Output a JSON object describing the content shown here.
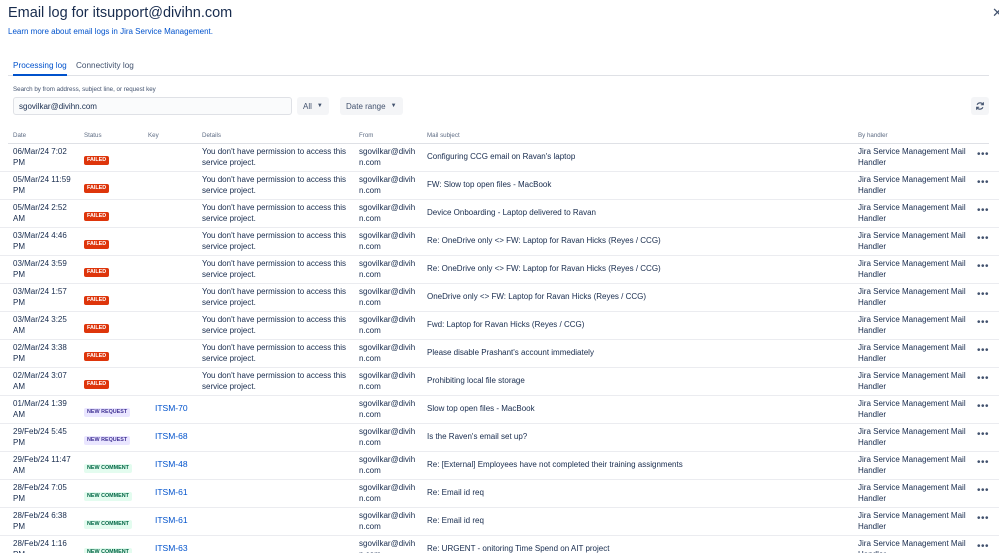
{
  "header": {
    "title": "Email log for itsupport@divihn.com",
    "learn_link": "Learn more about email logs in Jira Service Management."
  },
  "tabs": [
    {
      "label": "Processing log",
      "active": true
    },
    {
      "label": "Connectivity log",
      "active": false
    }
  ],
  "filters": {
    "search_label": "Search by from address, subject line, or request key",
    "search_value": "sgovilkar@divihn.com",
    "status_dropdown": "All",
    "date_dropdown": "Date range",
    "refresh_icon": "refresh-icon"
  },
  "columns": [
    "Date",
    "Status",
    "Key",
    "Details",
    "From",
    "Mail subject",
    "By handler"
  ],
  "status_colors": {
    "failed": "#DE350B",
    "new_request": "#EAE6FF",
    "new_comment": "#E3FCEF",
    "link": "#0052CC"
  },
  "rows": [
    {
      "date": "06/Mar/24 7:02 PM",
      "status": "FAILED",
      "status_type": "failed",
      "key": "",
      "details": "You don't have permission to access this service project.",
      "from": "sgovilkar@divihn.com",
      "subject": "Configuring CCG email on Ravan's laptop",
      "handler": "Jira Service Management Mail Handler",
      "more": "•••"
    },
    {
      "date": "05/Mar/24 11:59 PM",
      "status": "FAILED",
      "status_type": "failed",
      "key": "",
      "details": "You don't have permission to access this service project.",
      "from": "sgovilkar@divihn.com",
      "subject": "FW: Slow top open files - MacBook",
      "handler": "Jira Service Management Mail Handler",
      "more": "•••"
    },
    {
      "date": "05/Mar/24 2:52 AM",
      "status": "FAILED",
      "status_type": "failed",
      "key": "",
      "details": "You don't have permission to access this service project.",
      "from": "sgovilkar@divihn.com",
      "subject": "Device Onboarding - Laptop delivered to Ravan",
      "handler": "Jira Service Management Mail Handler",
      "more": "•••"
    },
    {
      "date": "03/Mar/24 4:46 PM",
      "status": "FAILED",
      "status_type": "failed",
      "key": "",
      "details": "You don't have permission to access this service project.",
      "from": "sgovilkar@divihn.com",
      "subject": "Re: OneDrive only <> FW: Laptop for Ravan Hicks (Reyes / CCG)",
      "handler": "Jira Service Management Mail Handler",
      "more": "•••"
    },
    {
      "date": "03/Mar/24 3:59 PM",
      "status": "FAILED",
      "status_type": "failed",
      "key": "",
      "details": "You don't have permission to access this service project.",
      "from": "sgovilkar@divihn.com",
      "subject": "Re: OneDrive only <> FW: Laptop for Ravan Hicks (Reyes / CCG)",
      "handler": "Jira Service Management Mail Handler",
      "more": "•••"
    },
    {
      "date": "03/Mar/24 1:57 PM",
      "status": "FAILED",
      "status_type": "failed",
      "key": "",
      "details": "You don't have permission to access this service project.",
      "from": "sgovilkar@divihn.com",
      "subject": "OneDrive only <> FW: Laptop for Ravan Hicks (Reyes / CCG)",
      "handler": "Jira Service Management Mail Handler",
      "more": "•••"
    },
    {
      "date": "03/Mar/24 3:25 AM",
      "status": "FAILED",
      "status_type": "failed",
      "key": "",
      "details": "You don't have permission to access this service project.",
      "from": "sgovilkar@divihn.com",
      "subject": "Fwd: Laptop for Ravan Hicks (Reyes / CCG)",
      "handler": "Jira Service Management Mail Handler",
      "more": "•••"
    },
    {
      "date": "02/Mar/24 3:38 PM",
      "status": "FAILED",
      "status_type": "failed",
      "key": "",
      "details": "You don't have permission to access this service project.",
      "from": "sgovilkar@divihn.com",
      "subject": "Please disable Prashant's account immediately",
      "handler": "Jira Service Management Mail Handler",
      "more": "•••"
    },
    {
      "date": "02/Mar/24 3:07 AM",
      "status": "FAILED",
      "status_type": "failed",
      "key": "",
      "details": "You don't have permission to access this service project.",
      "from": "sgovilkar@divihn.com",
      "subject": "Prohibiting local file storage",
      "handler": "Jira Service Management Mail Handler",
      "more": "•••"
    },
    {
      "date": "01/Mar/24 1:39 AM",
      "status": "NEW REQUEST",
      "status_type": "new-request",
      "key": "ITSM-70",
      "details": "",
      "from": "sgovilkar@divihn.com",
      "subject": "Slow top open files - MacBook",
      "handler": "Jira Service Management Mail Handler",
      "more": "•••"
    },
    {
      "date": "29/Feb/24 5:45 PM",
      "status": "NEW REQUEST",
      "status_type": "new-request",
      "key": "ITSM-68",
      "details": "",
      "from": "sgovilkar@divihn.com",
      "subject": "Is the Raven's email set up?",
      "handler": "Jira Service Management Mail Handler",
      "more": "•••"
    },
    {
      "date": "29/Feb/24 11:47 AM",
      "status": "NEW COMMENT",
      "status_type": "new-comment",
      "key": "ITSM-48",
      "details": "",
      "from": "sgovilkar@divihn.com",
      "subject": "Re: [External] Employees have not completed their training assignments",
      "handler": "Jira Service Management Mail Handler",
      "more": "•••"
    },
    {
      "date": "28/Feb/24 7:05 PM",
      "status": "NEW COMMENT",
      "status_type": "new-comment",
      "key": "ITSM-61",
      "details": "",
      "from": "sgovilkar@divihn.com",
      "subject": "Re: Email id req",
      "handler": "Jira Service Management Mail Handler",
      "more": "•••"
    },
    {
      "date": "28/Feb/24 6:38 PM",
      "status": "NEW COMMENT",
      "status_type": "new-comment",
      "key": "ITSM-61",
      "details": "",
      "from": "sgovilkar@divihn.com",
      "subject": "Re: Email id req",
      "handler": "Jira Service Management Mail Handler",
      "more": "•••"
    },
    {
      "date": "28/Feb/24 1:16 PM",
      "status": "NEW COMMENT",
      "status_type": "new-comment",
      "key": "ITSM-63",
      "details": "",
      "from": "sgovilkar@divihn.com",
      "subject": "Re: URGENT - onitoring Time Spend on AIT project",
      "handler": "Jira Service Management Mail Handler",
      "more": "•••"
    }
  ]
}
